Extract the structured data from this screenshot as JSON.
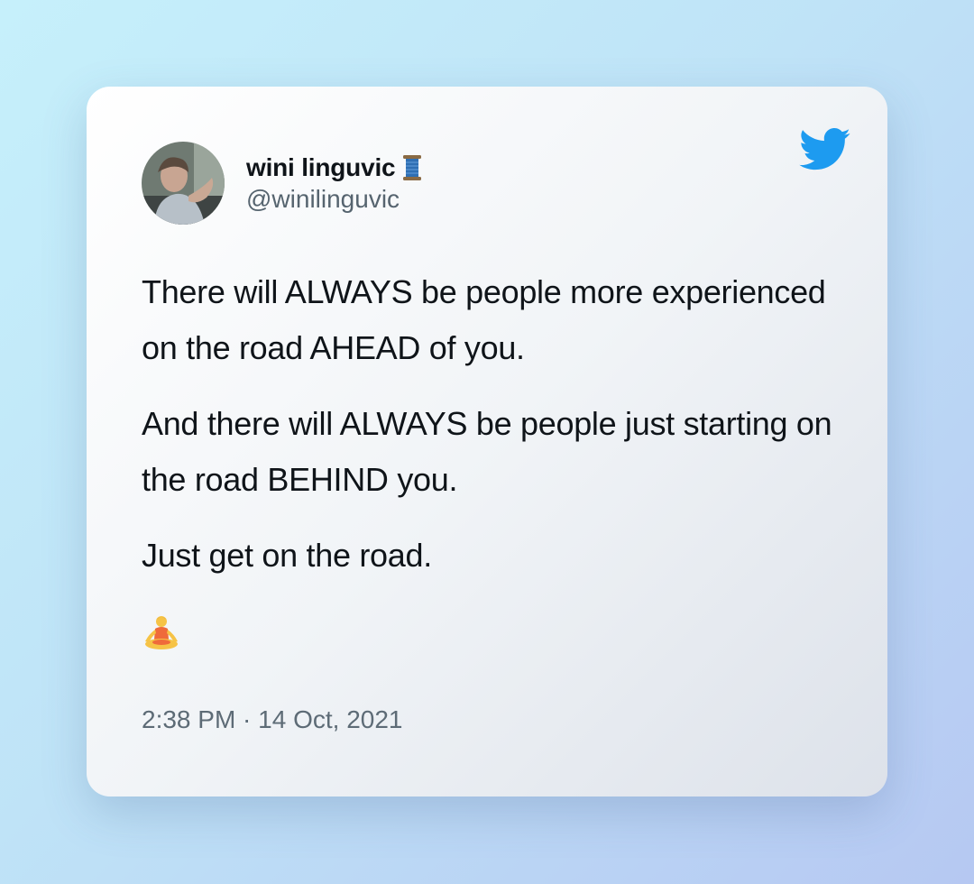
{
  "author": {
    "display_name": "wini linguvic",
    "name_emoji": "spool-of-thread-icon",
    "handle": "@winilinguvic",
    "avatar": "avatar-photo"
  },
  "tweet": {
    "paragraphs": [
      "There will ALWAYS be people more experienced on the road AHEAD of you.",
      "And there will ALWAYS be people just starting on the road BEHIND you.",
      "Just get on the road."
    ],
    "emoji": "person-in-lotus-position-icon",
    "timestamp": "2:38 PM · 14 Oct, 2021"
  },
  "platform": {
    "logo": "twitter-bird-icon",
    "brand_color": "#1d9bf0"
  },
  "colors": {
    "text_primary": "#0f1419",
    "text_secondary": "#56646f"
  }
}
